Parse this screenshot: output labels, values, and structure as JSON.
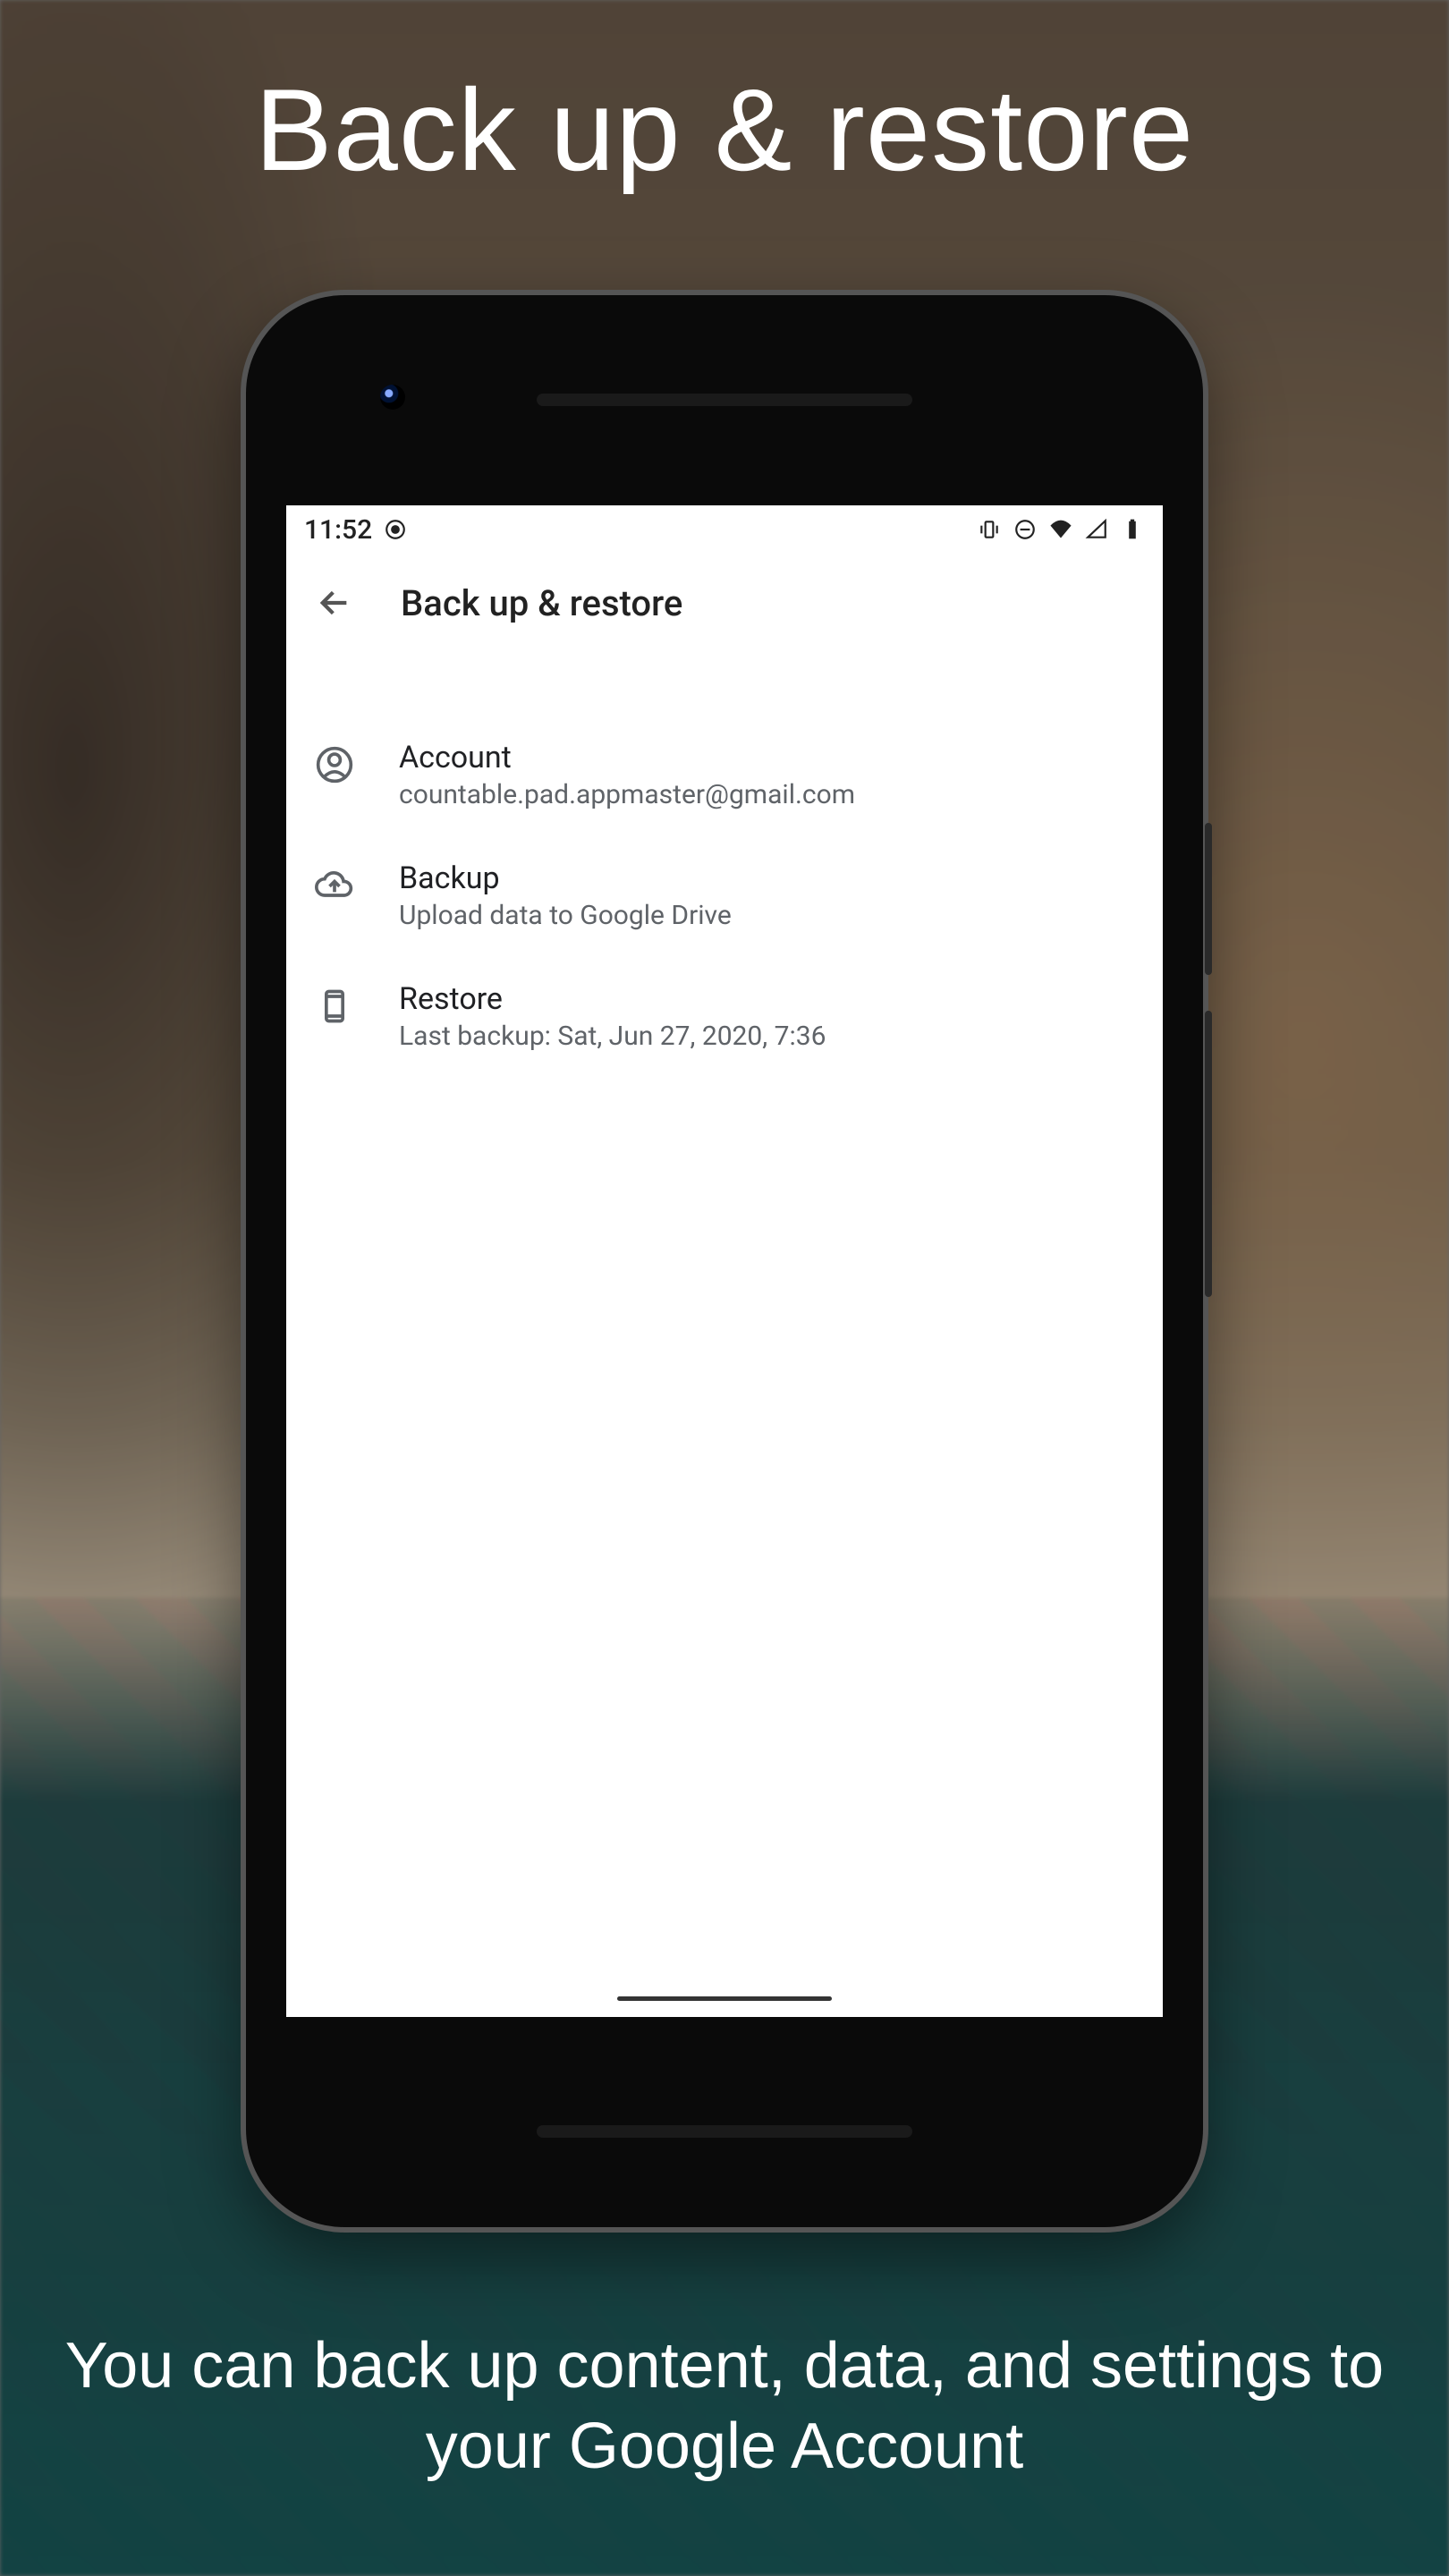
{
  "promo": {
    "title": "Back up & restore",
    "bottom": "You can back up content, data, and settings to your Google Account"
  },
  "statusbar": {
    "time": "11:52"
  },
  "appbar": {
    "title": "Back up & restore"
  },
  "settings": {
    "account": {
      "title": "Account",
      "subtitle": "countable.pad.appmaster@gmail.com"
    },
    "backup": {
      "title": "Backup",
      "subtitle": "Upload data to Google Drive"
    },
    "restore": {
      "title": "Restore",
      "subtitle": "Last backup: Sat, Jun 27, 2020, 7:36"
    }
  }
}
